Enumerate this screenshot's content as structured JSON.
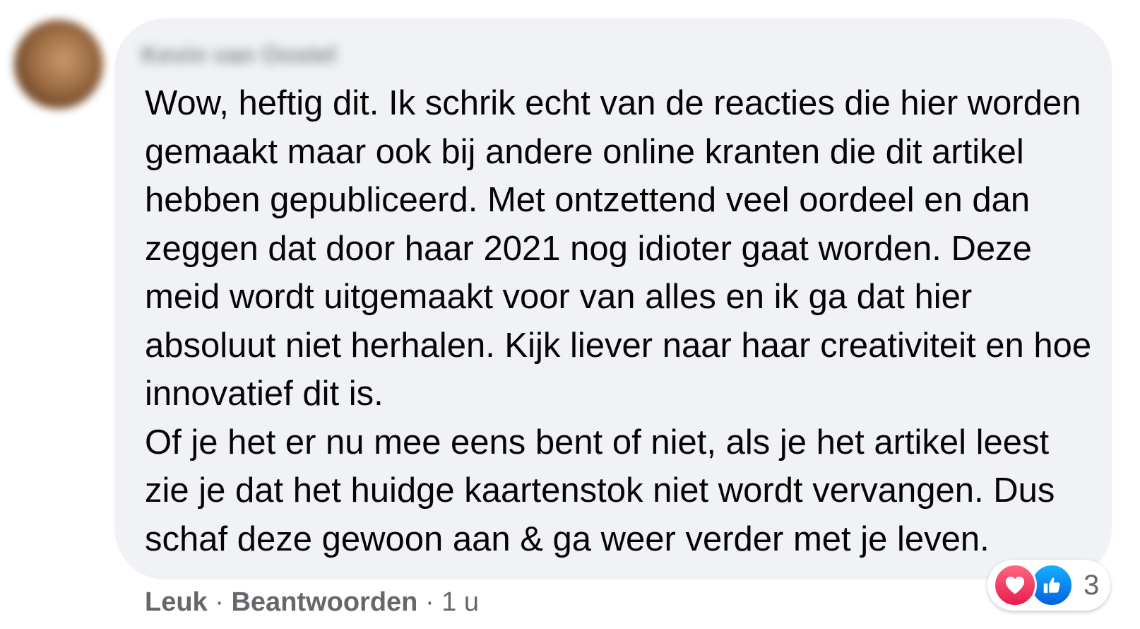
{
  "comment": {
    "author": "Kevin van Oostel",
    "paragraphs": [
      "Wow, heftig dit. Ik schrik echt van de reacties die hier worden gemaakt maar ook bij andere online kranten die dit artikel hebben gepubliceerd. Met ontzettend veel oordeel en dan zeggen dat door haar 2021 nog idioter gaat worden. Deze meid wordt uitgemaakt voor van alles en ik ga dat hier absoluut niet herhalen. Kijk liever naar haar creativiteit en hoe innovatief dit is.",
      "Of je het er nu mee eens bent of niet, als je het artikel leest zie je dat het huidge kaartenstok niet wordt vervangen. Dus schaf deze gewoon aan & ga weer verder met je leven."
    ]
  },
  "actions": {
    "like_label": "Leuk",
    "separator": " · ",
    "reply_label": "Beantwoorden",
    "time": "1 u"
  },
  "reactions": {
    "icons": [
      "heart-icon",
      "thumbs-up-icon"
    ],
    "count": "3",
    "colors": {
      "love": "#f33e58",
      "like": "#1877f2"
    }
  }
}
